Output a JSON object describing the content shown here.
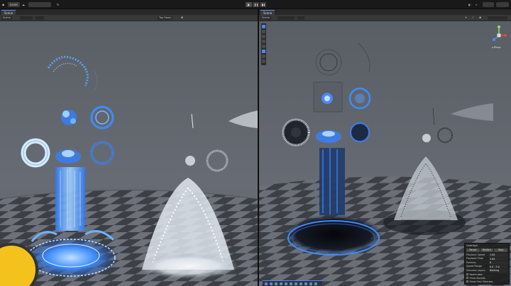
{
  "app": {
    "title": "Level",
    "scene_tab_label": "Scene",
    "toolbar_left": "Scene",
    "toolbar_zoom": "Top Down",
    "toolbar_right_label": "Scene"
  },
  "overlay": {
    "title": "Overlays",
    "buttons": [
      "Pause",
      "Restart",
      "Stop"
    ],
    "rows": [
      {
        "label": "Playback Speed",
        "value": "1.00"
      },
      {
        "label": "Playback Time",
        "value": "3.00"
      },
      {
        "label": "Particles",
        "value": "0"
      },
      {
        "label": "Speed Range",
        "value": "0.0 - 5.0"
      },
      {
        "label": "Simulate Layers",
        "value": "Nothing"
      }
    ],
    "checks": [
      "Resimulate",
      "Show Bounds",
      "Show Only Selected"
    ]
  },
  "colors": {
    "accent": "#4c89ff",
    "sky": "#5d626a",
    "floor_dark": "#3a3d44",
    "floor_light": "#6f737b",
    "fx_blue": "#3d8cff",
    "fx_white": "#e8eef4"
  },
  "icons": {
    "play": "play-icon",
    "pause": "pause-icon",
    "step": "step-icon",
    "gizmo": "axis-gizmo-icon"
  }
}
